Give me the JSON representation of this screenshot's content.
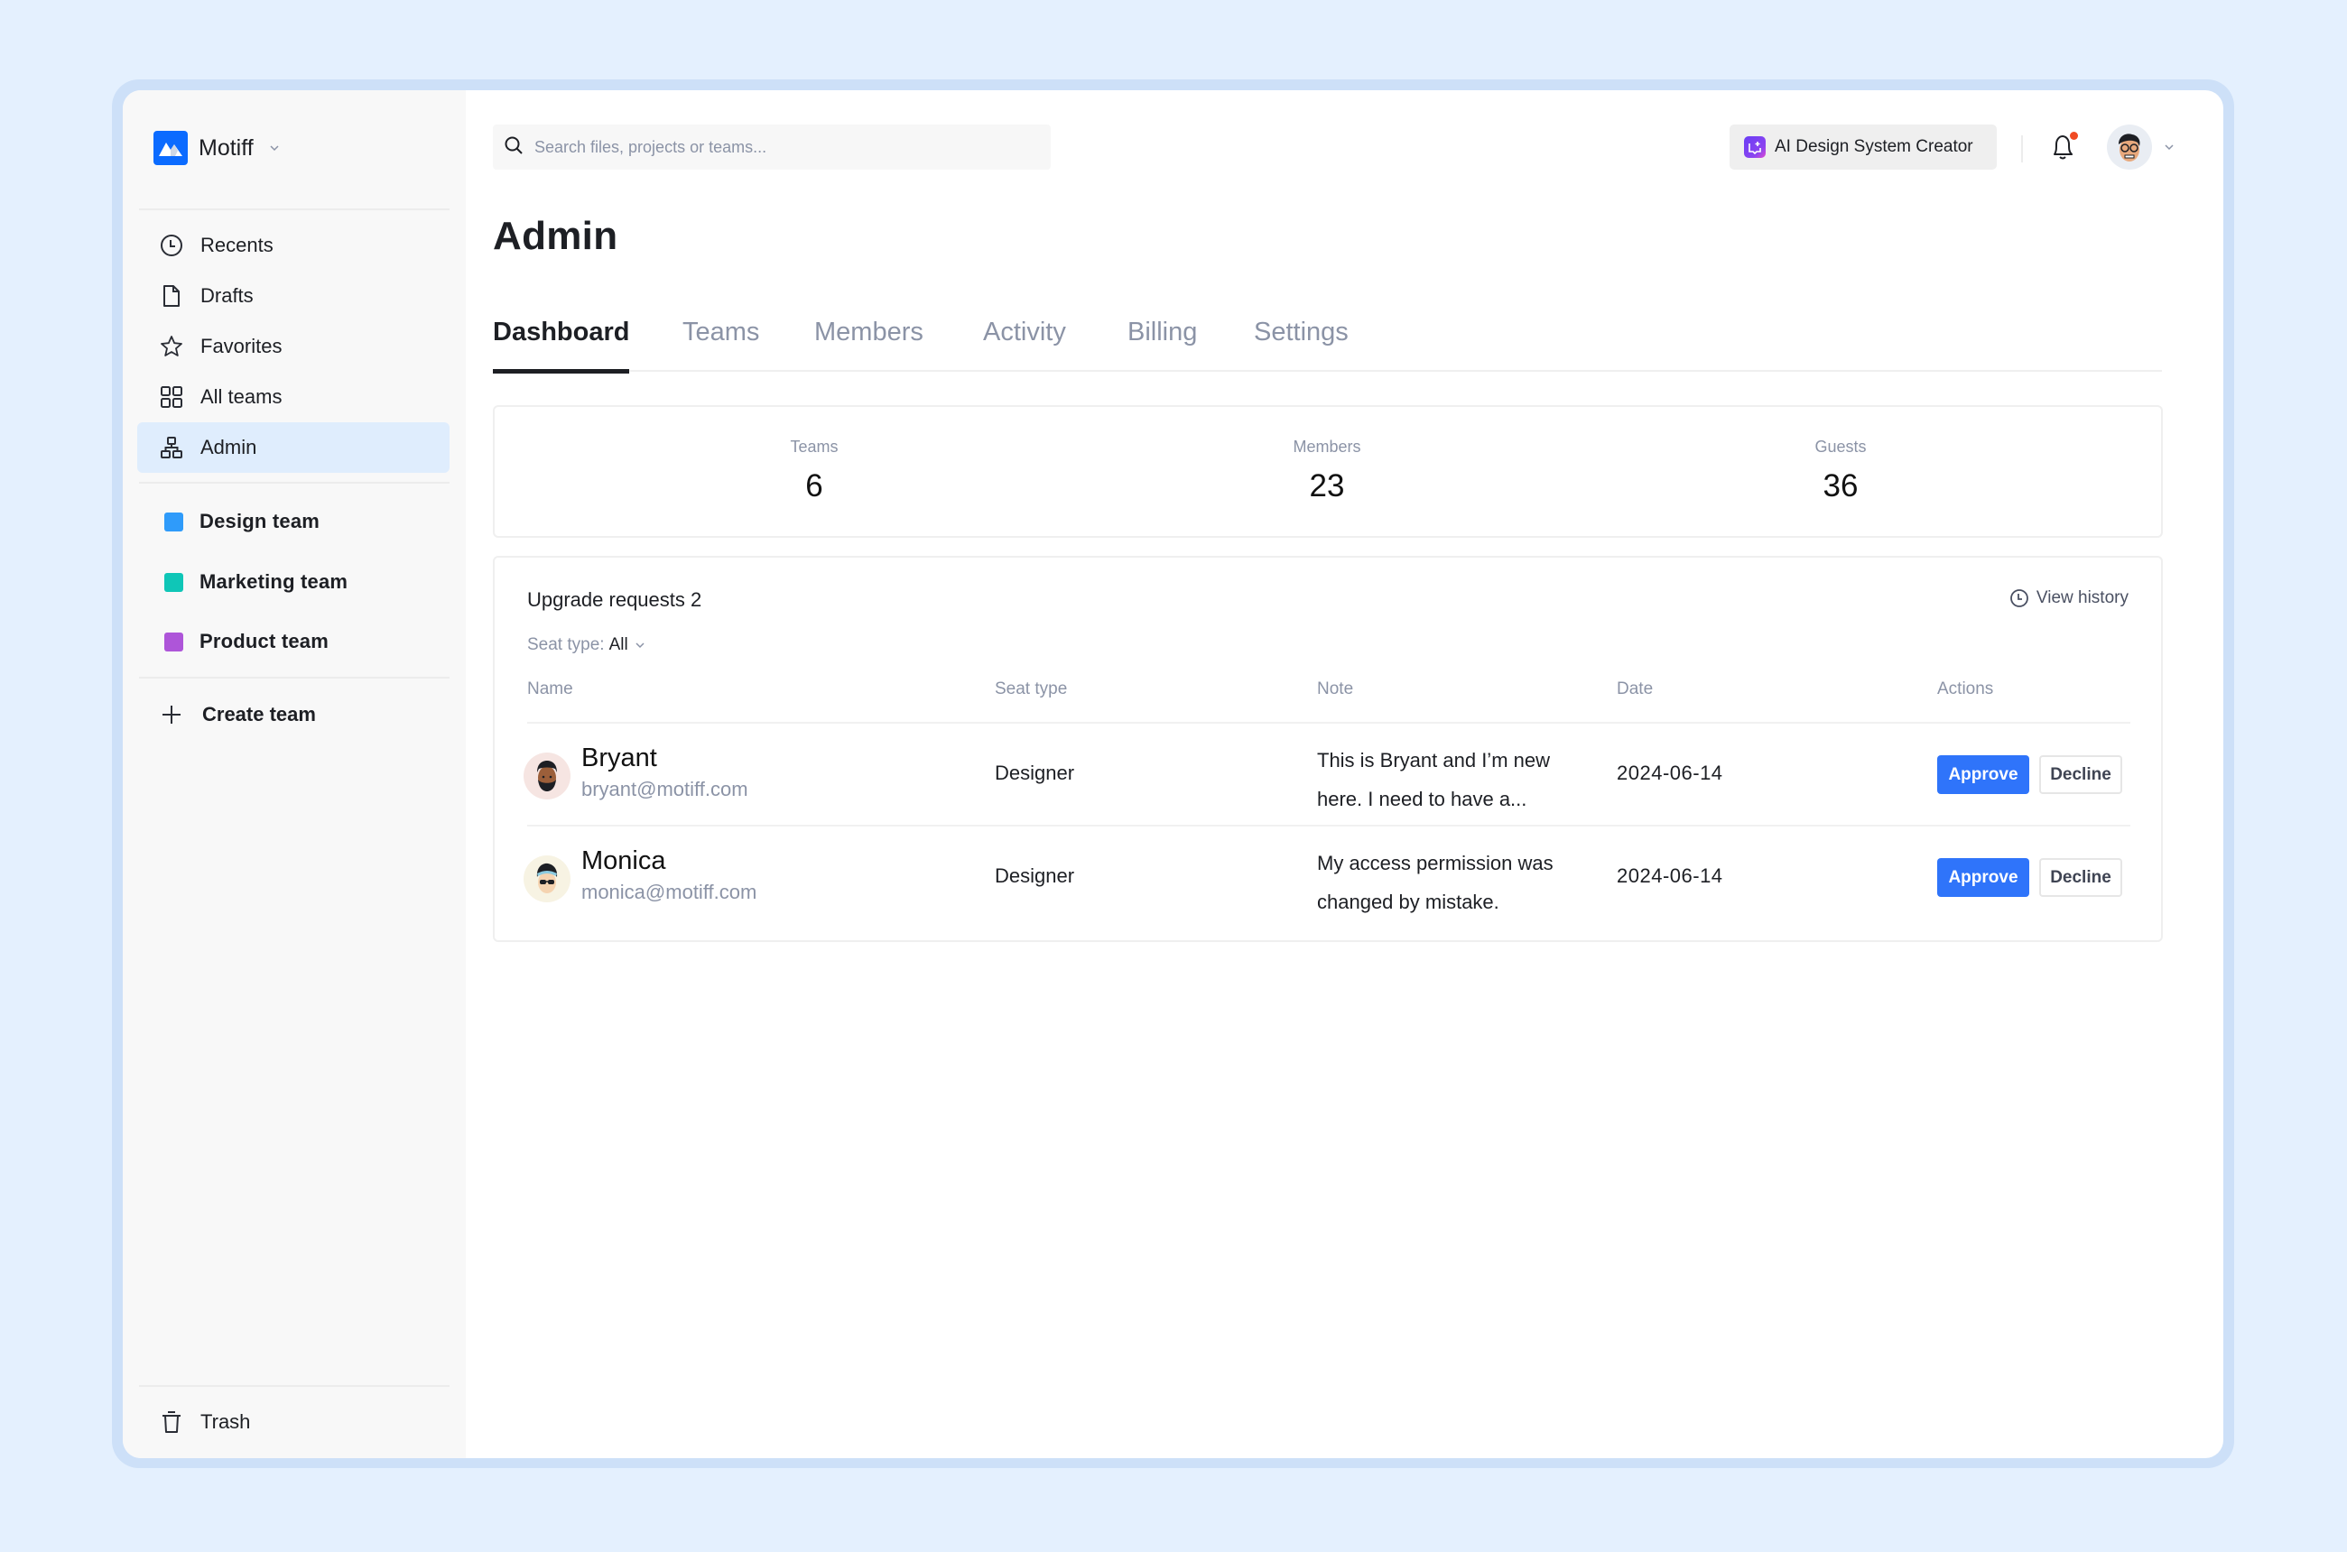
{
  "app": {
    "name": "Motiff",
    "brand_color": "#0b6bff"
  },
  "sidebar": {
    "nav": [
      {
        "id": "recents",
        "label": "Recents",
        "icon": "clock-icon"
      },
      {
        "id": "drafts",
        "label": "Drafts",
        "icon": "file-icon"
      },
      {
        "id": "favorites",
        "label": "Favorites",
        "icon": "star-icon"
      },
      {
        "id": "all-teams",
        "label": "All teams",
        "icon": "grid-icon"
      },
      {
        "id": "admin",
        "label": "Admin",
        "icon": "org-chart-icon",
        "active": true
      }
    ],
    "teams": [
      {
        "label": "Design team",
        "color": "#2f9bfa"
      },
      {
        "label": "Marketing team",
        "color": "#0fc6b7"
      },
      {
        "label": "Product team",
        "color": "#ae55d9"
      }
    ],
    "create_team": "Create team",
    "trash": "Trash"
  },
  "header": {
    "search_placeholder": "Search files, projects or teams...",
    "search_value": "",
    "ai_button": "AI Design System Creator",
    "has_notification": true
  },
  "page": {
    "title": "Admin",
    "tabs": [
      {
        "label": "Dashboard",
        "active": true
      },
      {
        "label": "Teams"
      },
      {
        "label": "Members"
      },
      {
        "label": "Activity"
      },
      {
        "label": "Billing"
      },
      {
        "label": "Settings"
      }
    ]
  },
  "stats": [
    {
      "label": "Teams",
      "value": "6"
    },
    {
      "label": "Members",
      "value": "23"
    },
    {
      "label": "Guests",
      "value": "36"
    }
  ],
  "requests": {
    "title": "Upgrade requests 2",
    "view_history": "View history",
    "filter_label": "Seat type:",
    "filter_value": "All",
    "columns": [
      "Name",
      "Seat type",
      "Note",
      "Date",
      "Actions"
    ],
    "rows": [
      {
        "name": "Bryant",
        "email": "bryant@motiff.com",
        "seat_type": "Designer",
        "note": "This is Bryant and I’m new here. I need to have a...",
        "date": "2024-06-14",
        "approve": "Approve",
        "decline": "Decline"
      },
      {
        "name": "Monica",
        "email": "monica@motiff.com",
        "seat_type": "Designer",
        "note": "My access permission was changed by mistake.",
        "date": "2024-06-14",
        "approve": "Approve",
        "decline": "Decline"
      }
    ]
  },
  "help_label": "?",
  "colors": {
    "primary": "#2f74fa",
    "notification": "#f04a23",
    "active_nav": "#dfedfd"
  }
}
